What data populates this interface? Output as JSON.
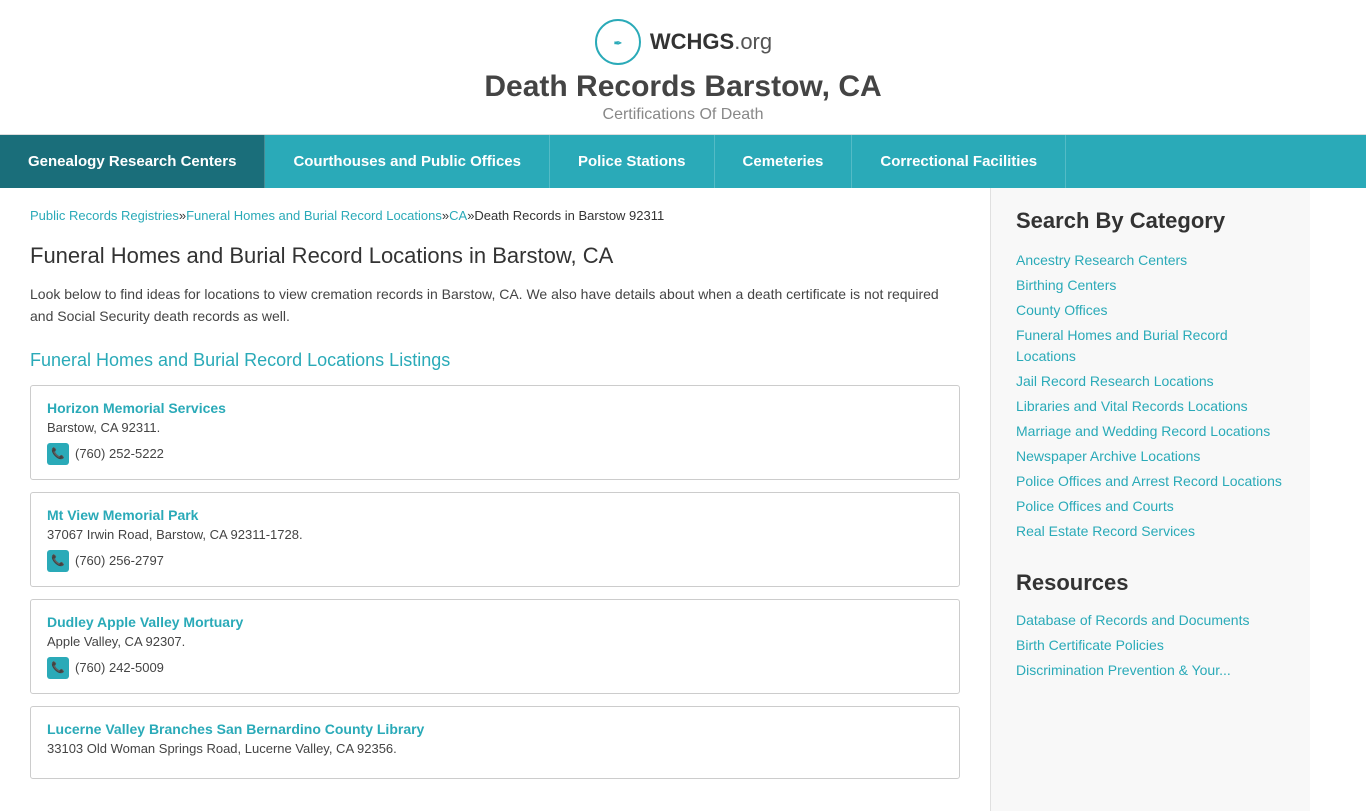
{
  "header": {
    "site_name": "WCHGS",
    "site_name_suffix": ".org",
    "page_title": "Death Records Barstow, CA",
    "page_subtitle": "Certifications Of Death"
  },
  "nav": {
    "items": [
      "Genealogy Research Centers",
      "Courthouses and Public Offices",
      "Police Stations",
      "Cemeteries",
      "Correctional Facilities"
    ]
  },
  "breadcrumb": {
    "links": [
      "Public Records Registries",
      "Funeral Homes and Burial Record Locations",
      "CA",
      "Death Records in Barstow 92311"
    ],
    "separator": "»"
  },
  "content": {
    "main_heading": "Funeral Homes and Burial Record Locations in Barstow, CA",
    "description": "Look below to find ideas for locations to view cremation records in Barstow, CA. We also have details about when a death certificate is not required and Social Security death records as well.",
    "listings_heading": "Funeral Homes and Burial Record Locations Listings",
    "listings": [
      {
        "name": "Horizon Memorial Services",
        "address": "Barstow, CA 92311.",
        "phone": "(760) 252-5222"
      },
      {
        "name": "Mt View Memorial Park",
        "address": "37067 Irwin Road, Barstow, CA 92311-1728.",
        "phone": "(760) 256-2797"
      },
      {
        "name": "Dudley Apple Valley Mortuary",
        "address": "Apple Valley, CA 92307.",
        "phone": "(760) 242-5009"
      },
      {
        "name": "Lucerne Valley Branches San Bernardino County Library",
        "address": "33103 Old Woman Springs Road, Lucerne Valley, CA 92356.",
        "phone": ""
      }
    ]
  },
  "sidebar": {
    "search_category_title": "Search By Category",
    "categories": [
      "Ancestry Research Centers",
      "Birthing Centers",
      "County Offices",
      "Funeral Homes and Burial Record Locations",
      "Jail Record Research Locations",
      "Libraries and Vital Records Locations",
      "Marriage and Wedding Record Locations",
      "Newspaper Archive Locations",
      "Police Offices and Arrest Record Locations",
      "Police Offices and Courts",
      "Real Estate Record Services"
    ],
    "resources_title": "Resources",
    "resources": [
      "Database of Records and Documents",
      "Birth Certificate Policies",
      "Discrimination Prevention & Your..."
    ]
  }
}
